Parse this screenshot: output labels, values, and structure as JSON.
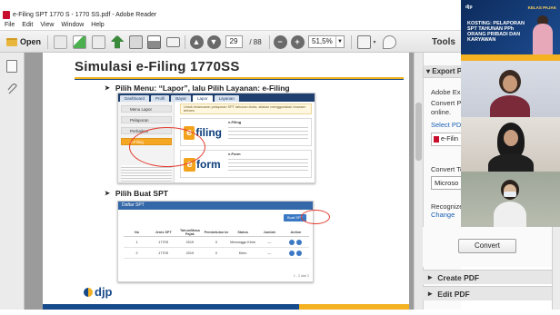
{
  "app": {
    "title": "e-Filing SPT 1770 S - 1770 SS.pdf - Adobe Reader",
    "window_controls": [
      "–",
      "☐",
      "✕"
    ]
  },
  "menu": [
    "File",
    "Edit",
    "View",
    "Window",
    "Help"
  ],
  "toolbar": {
    "open_label": "Open",
    "page_current": "29",
    "page_total": "/ 88",
    "zoom": "51,5%",
    "tools_label": "Tools"
  },
  "slide": {
    "title": "Simulasi e-Filing 1770SS",
    "bullet1": "Pilih Menu: “Lapor”, lalu Pilih Layanan: e-Filing",
    "bullet2": "Pilih Buat SPT",
    "shot1": {
      "tabs": [
        "Dashboard",
        "Profil",
        "Bayar",
        "Lapor",
        "Layanan"
      ],
      "side_items": [
        "Menu Lapor",
        "Pelaporan",
        "Perbaikan",
        "e-Filing"
      ],
      "banner": "Untuk kelancaran pelaporan SPT tahunan Anda, silakan menggunakan browser terbaru",
      "efiling_logo_e": "e",
      "efiling_logo_word": "filing",
      "eform_logo_e": "e",
      "eform_logo_word": "form",
      "card1_heading": "e-Filing",
      "card2_heading": "e-Form"
    },
    "shot2": {
      "header": "Daftar SPT",
      "buat_button": "Buat SPT",
      "columns": [
        "No",
        "Jenis SPT",
        "Tahun/Masa Pajak",
        "Pembetulan ke",
        "Status",
        "Jumlah",
        "Action"
      ],
      "rows": [
        [
          "1",
          "1770S",
          "2019",
          "0",
          "Menunggu Kirim",
          "—",
          ""
        ],
        [
          "2",
          "1770S",
          "2019",
          "0",
          "Kirim",
          "—",
          ""
        ]
      ],
      "footer": "1 - 2 dari 2"
    },
    "logo": "djp"
  },
  "right_pane": {
    "export_header": "Export PDF",
    "adobe_line": "Adobe Exp",
    "convert_line1": "Convert PD",
    "convert_line2": "online.",
    "select_pdf": "Select PDF",
    "file_chip": "e-Filin",
    "convert_to": "Convert To",
    "format_select": "Microso",
    "recognize": "Recognize",
    "change_link": "Change",
    "convert_button": "Convert",
    "create_pdf": "Create PDF",
    "edit_pdf": "Edit PDF"
  },
  "video": {
    "banner_head": "KOSTING: PELAPORAN SPT TAHUNAN PPh ORANG PRIBADI DAN KARYAWAN",
    "banner_kp": "KELAS PAJAK",
    "banner_org": "djp"
  }
}
